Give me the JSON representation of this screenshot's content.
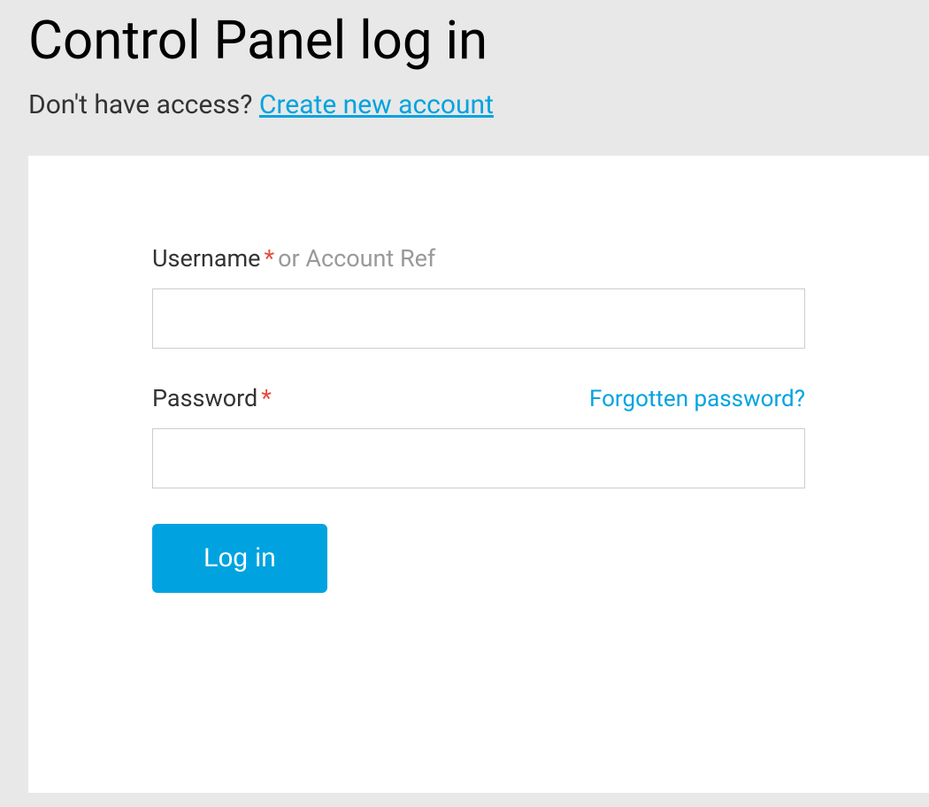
{
  "header": {
    "title": "Control Panel log in",
    "subtitle_prefix": "Don't have access? ",
    "create_account_link": "Create new account"
  },
  "form": {
    "username": {
      "label": "Username",
      "required_marker": "*",
      "hint": "or Account Ref",
      "value": ""
    },
    "password": {
      "label": "Password",
      "required_marker": "*",
      "forgot_link": "Forgotten password?",
      "value": ""
    },
    "submit_label": "Log in"
  }
}
